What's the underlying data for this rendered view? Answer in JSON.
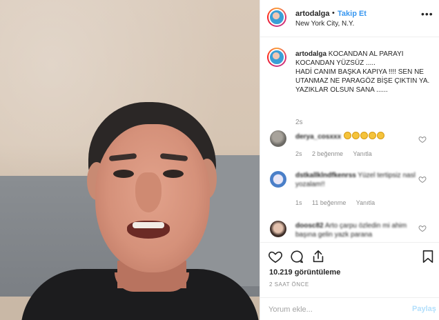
{
  "header": {
    "username": "artodalga",
    "separator": "•",
    "follow_label": "Takip Et",
    "location": "New York City, N.Y.",
    "more_label": "•••"
  },
  "caption": {
    "username": "artodalga",
    "text_1": "KOCANDAN AL PARAYI KOCANDAN YÜZSÜZ .....",
    "text_2": "HADİ CANIM BAŞKA KAPIYA !!!! SEN NE UTANMAZ NE PARAGÖZ BİŞE ÇIKTIN YA. YAZIKLAR OLSUN SANA ......",
    "time": "2s"
  },
  "comments": [
    {
      "username": "derya_cosxxx",
      "text": "",
      "time": "2s",
      "likes": "2 beğenme",
      "reply": "Yanıtla"
    },
    {
      "username": "dstkallklndfkenrss",
      "text": "Yüzel tertipsiz nasl yozalam!!",
      "time": "1s",
      "likes": "11 beğenme",
      "reply": "Yanıtla"
    },
    {
      "username": "doosc82",
      "text": "Arto çarpu özledin mi ahim başına gelin yazk parana",
      "time": "",
      "likes": "",
      "reply": ""
    }
  ],
  "actions": {
    "views": "10.219 görüntüleme",
    "time_ago": "2 SAAT ÖNCE"
  },
  "add_comment": {
    "placeholder": "Yorum ekle...",
    "post_label": "Paylaş"
  },
  "colors": {
    "accent": "#3897f0",
    "post_disabled": "#b2dffc",
    "muted": "#8e8e8e"
  }
}
